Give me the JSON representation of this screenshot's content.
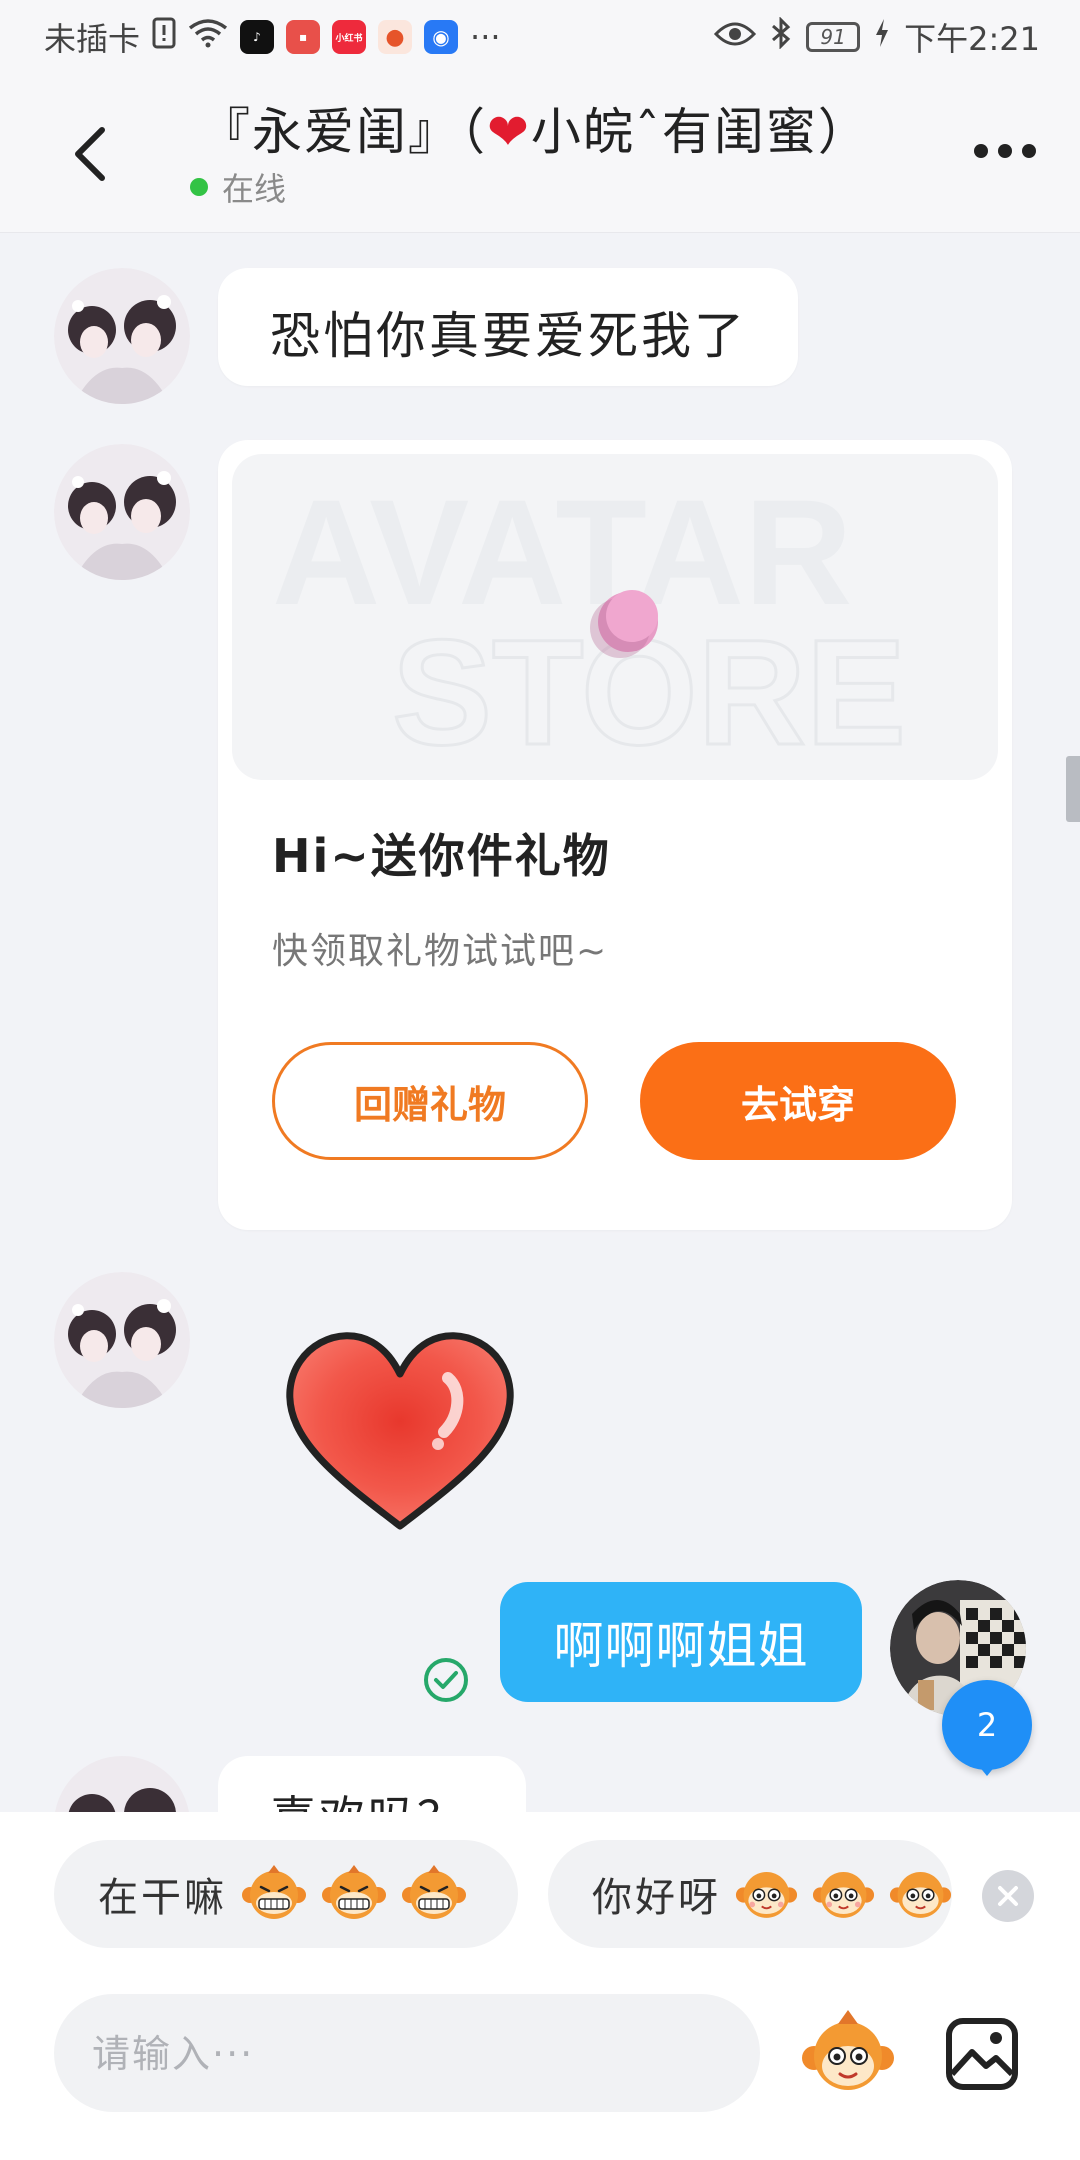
{
  "status_bar": {
    "carrier": "未插卡",
    "time": "下午2:21",
    "battery": "91",
    "apps": [
      {
        "name": "tiktok-icon",
        "color": "#111111",
        "glyph": "♪"
      },
      {
        "name": "huawei-store-icon",
        "color": "#e8504a",
        "glyph": "▪"
      },
      {
        "name": "xiaohongshu-icon",
        "color": "#ee2a3c",
        "glyph": "小红书"
      },
      {
        "name": "app-orange-icon",
        "color": "#e6542a",
        "glyph": "●"
      },
      {
        "name": "bulb-app-icon",
        "color": "#2879f5",
        "glyph": "◉"
      }
    ]
  },
  "header": {
    "title_left": "『永爱闺』（",
    "title_heart": "❤",
    "title_right": "小皖ˆ有闺蜜）",
    "online": "在线"
  },
  "messages": {
    "msg1": "恐怕你真要爱死我了",
    "gift_card": {
      "title": "Hi~送你件礼物",
      "subtitle": "快领取礼物试试吧~",
      "watermark_line1": "AVATAR",
      "watermark_line2": "STORE",
      "btn_return": "回赠礼物",
      "btn_try": "去试穿"
    },
    "outgoing": "啊啊啊姐姐",
    "unread_badge": "2",
    "partial": "喜欢吗？"
  },
  "quick_replies": [
    {
      "text": "在干嘛",
      "emoji_count": 3
    },
    {
      "text": "你好呀",
      "emoji_count": 3
    }
  ],
  "input": {
    "placeholder": "请输入···"
  },
  "colors": {
    "accent_orange": "#fb6f16",
    "outgoing_blue": "#2fb3f7",
    "online_green": "#33c345",
    "badge_blue": "#1f8ff7"
  }
}
